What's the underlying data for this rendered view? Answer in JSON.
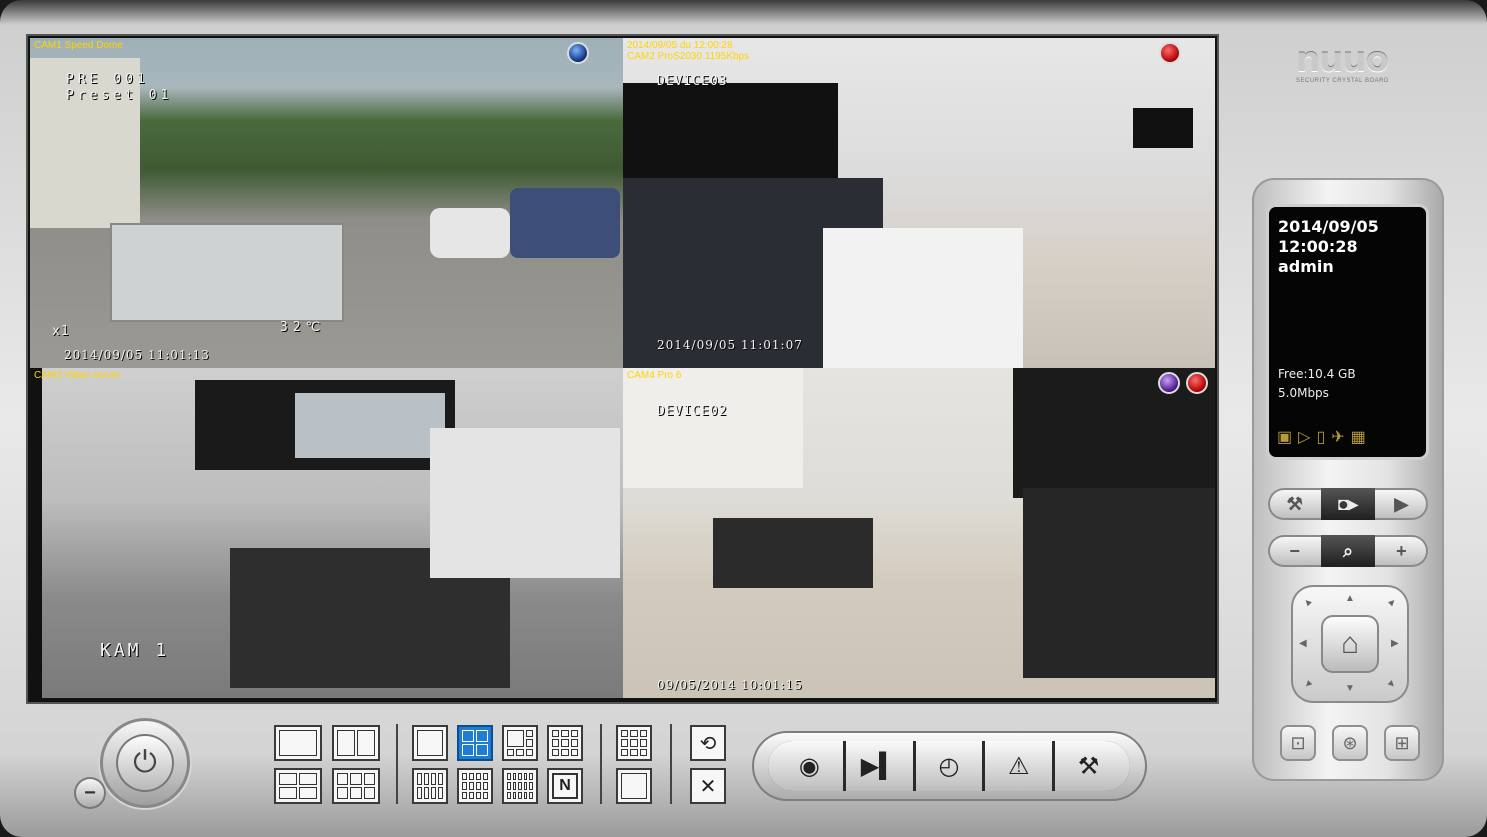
{
  "cameras": [
    {
      "label": "CAM1 Speed Dome",
      "osd_lines": [
        "PRE 001",
        "Preset 01"
      ],
      "zoom": "x1",
      "temp": "32℃",
      "timestamp": "2014/09/05 11:01:13",
      "indicators": [
        "blue"
      ]
    },
    {
      "label_line1": "2014/09/05 du 12:00:28",
      "label_line2": "CAM2 ProS2030 1195Kbps",
      "device": "DEVICE03",
      "timestamp": "2014/09/05 11:01:07",
      "indicators": [
        "red"
      ]
    },
    {
      "label": "CAM3 Video server",
      "osd": "KAM 1",
      "indicators": []
    },
    {
      "label": "CAM4 Pro 6",
      "device": "DEVICE02",
      "timestamp": "09/05/2014 10:01:15",
      "indicators": [
        "purple",
        "red"
      ]
    }
  ],
  "logo": {
    "brand": "nuuo",
    "tagline": "SECURITY CRYSTAL BOARD"
  },
  "status_display": {
    "date": "2014/09/05",
    "time": "12:00:28",
    "user": "admin",
    "free_space": "Free:10.4 GB",
    "bitrate": "5.0Mbps",
    "icons": [
      "monitor-icon",
      "playback-icon",
      "mobile-icon",
      "satellite-icon",
      "keyboard-icon"
    ]
  },
  "ptz_controls": {
    "top_row": [
      "wrench-icon",
      "ptz-camera-icon",
      "play-icon"
    ],
    "zoom_row": {
      "minus": "−",
      "plus": "+",
      "middle": "magnifier-icon"
    },
    "pad_center": "home-icon",
    "bottom_buttons": [
      "focus-icon",
      "auto-focus-icon",
      "preset-icon"
    ]
  },
  "layouts": {
    "group1": [
      "1x1",
      "1x2",
      "2x2",
      "2x3"
    ],
    "group2": [
      "single",
      "2x2",
      "3x3-variant",
      "3x3",
      "4x4",
      "5x5",
      "6x6",
      "custom"
    ],
    "custom_label": "N",
    "group3": [
      "grid",
      "grid-alt"
    ],
    "active": "2x2"
  },
  "toolbar": [
    "record-icon",
    "playback-icon",
    "schedule-icon",
    "alarm-icon",
    "hammer-icon"
  ],
  "accent": "#1e7ed3"
}
